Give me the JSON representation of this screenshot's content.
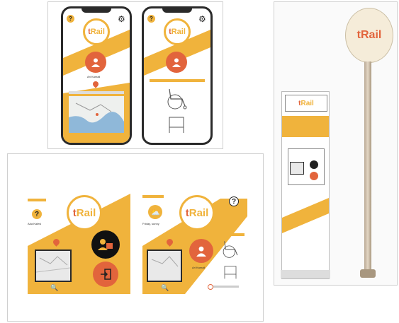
{
  "brand": {
    "logo": "tRail",
    "logo_t": "t",
    "logo_rest": "Rail"
  },
  "colors": {
    "yellow": "#f0b33c",
    "orange": "#e2643c",
    "dark": "#222222"
  },
  "phones": {
    "left": {
      "help": "?",
      "user_label": "Ari Kamali"
    },
    "right": {
      "help": "?"
    }
  },
  "tablets": {
    "left": {
      "help": "?",
      "weather_label": "Ada Kalesi"
    },
    "right": {
      "help": "?",
      "weather_label": "Friday, sunny",
      "user_label": "Ari Kamali"
    }
  },
  "kiosk": {
    "sign": "tRail"
  }
}
